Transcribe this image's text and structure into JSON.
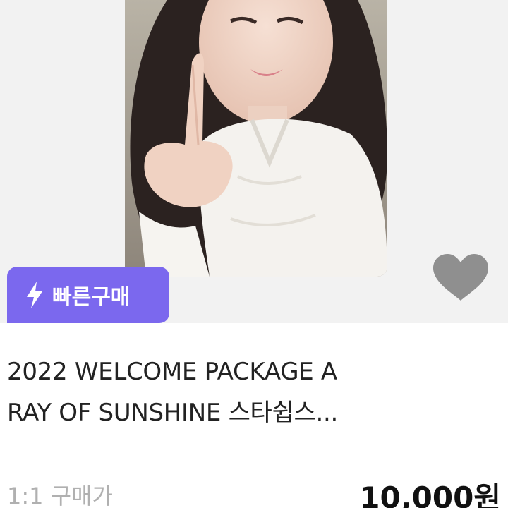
{
  "listing": {
    "badge_label": "빠른구매",
    "badge_color": "#7b68ee",
    "heart_color": "#8f8f8f",
    "title_line_1": "2022 WELCOME PACKAGE A",
    "title_line_2": "RAY OF SUNSHINE 스타쉽스...",
    "trade_type": "1:1 구매가",
    "price": "10,000원"
  },
  "icons": {
    "badge_icon": "lightning-bolt-icon",
    "favorite_icon": "heart-icon"
  }
}
